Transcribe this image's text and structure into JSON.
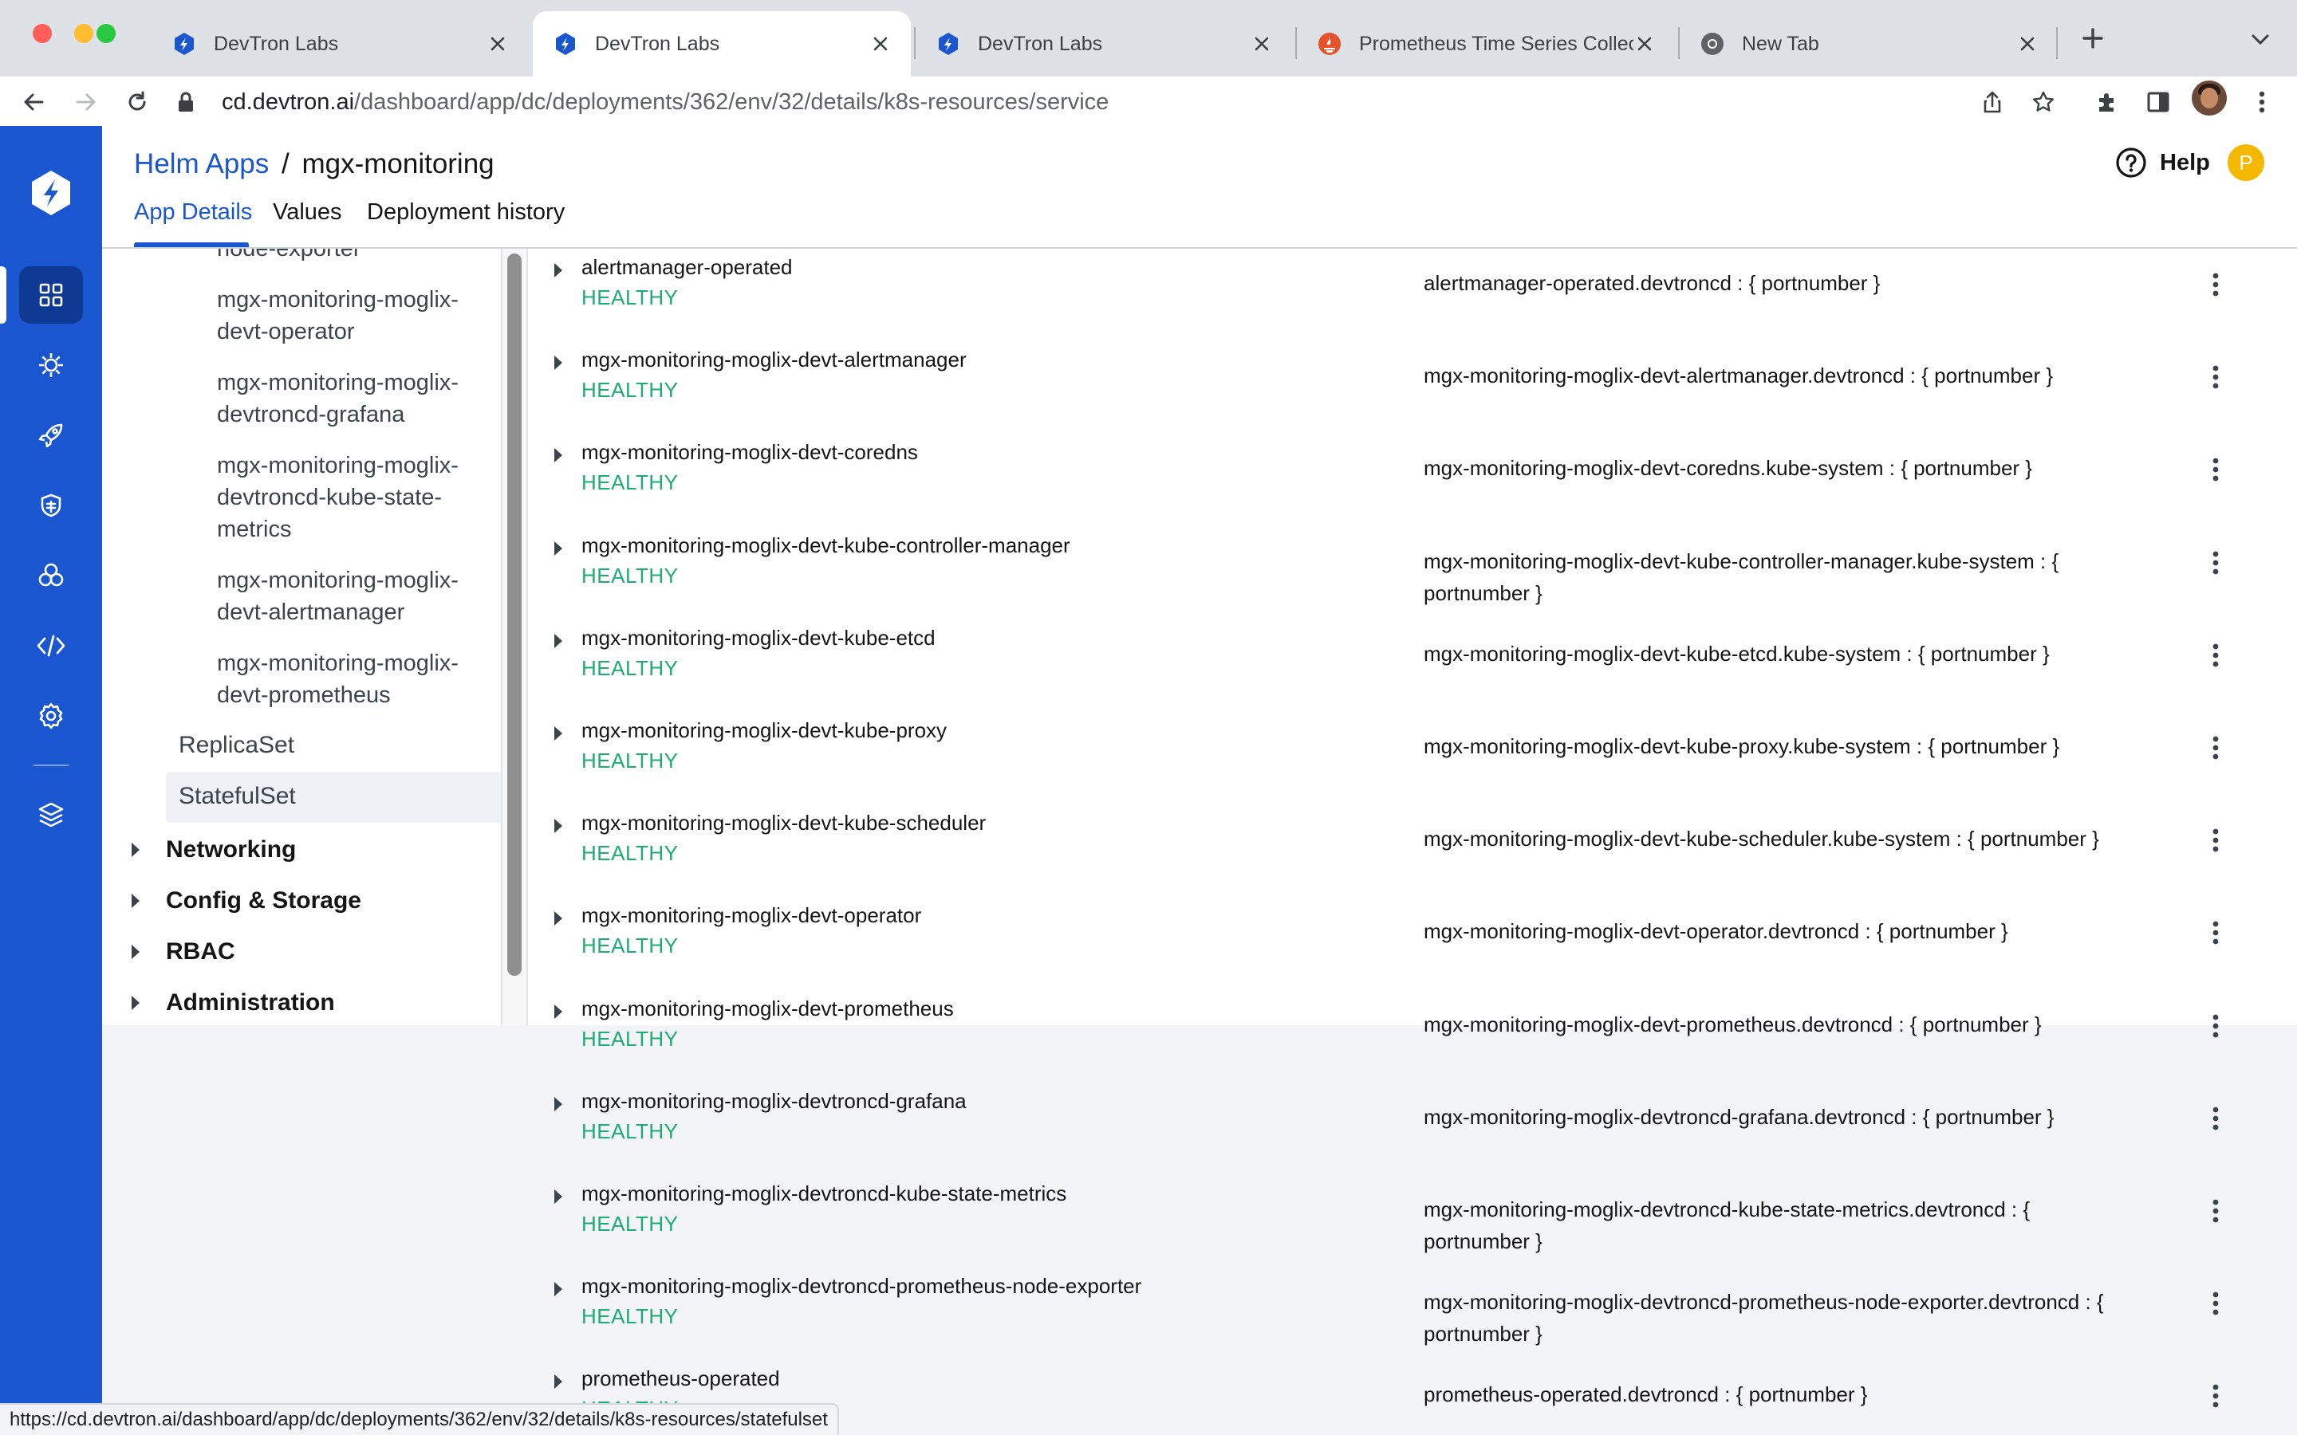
{
  "browser": {
    "tabs": [
      {
        "title": "DevTron Labs",
        "favicon": "devtron-favicon-icon",
        "active": false
      },
      {
        "title": "DevTron Labs",
        "favicon": "devtron-favicon-icon",
        "active": true
      },
      {
        "title": "DevTron Labs",
        "favicon": "devtron-favicon-icon",
        "active": false
      },
      {
        "title": "Prometheus Time Series Collec",
        "favicon": "prometheus-favicon-icon",
        "active": false
      },
      {
        "title": "New Tab",
        "favicon": "chrome-favicon-icon",
        "active": false
      }
    ],
    "url_domain": "cd.devtron.ai",
    "url_path": "/dashboard/app/dc/deployments/362/env/32/details/k8s-resources/service",
    "status_url": "https://cd.devtron.ai/dashboard/app/dc/deployments/362/env/32/details/k8s-resources/statefulset"
  },
  "header": {
    "breadcrumb_root": "Helm Apps",
    "breadcrumb_sep": "/",
    "breadcrumb_current": "mgx-monitoring",
    "help_label": "Help",
    "user_initial": "P",
    "tabs": [
      {
        "label": "App Details",
        "active": true
      },
      {
        "label": "Values",
        "active": false
      },
      {
        "label": "Deployment history",
        "active": false
      }
    ]
  },
  "tree": {
    "cut_leaf": "node-exporter",
    "leaves": [
      [
        "mgx-monitoring-moglix-",
        "devt-operator"
      ],
      [
        "mgx-monitoring-moglix-",
        "devtroncd-grafana"
      ],
      [
        "mgx-monitoring-moglix-",
        "devtroncd-kube-state-",
        "metrics"
      ],
      [
        "mgx-monitoring-moglix-",
        "devt-alertmanager"
      ],
      [
        "mgx-monitoring-moglix-",
        "devt-prometheus"
      ]
    ],
    "kinds": [
      "ReplicaSet",
      "StatefulSet"
    ],
    "selected_kind": "StatefulSet",
    "groups": [
      "Networking",
      "Config & Storage",
      "RBAC",
      "Administration"
    ]
  },
  "services": [
    {
      "name": "alertmanager-operated",
      "status": "HEALTHY",
      "endpoint": "alertmanager-operated.devtroncd : { portnumber }"
    },
    {
      "name": "mgx-monitoring-moglix-devt-alertmanager",
      "status": "HEALTHY",
      "endpoint": "mgx-monitoring-moglix-devt-alertmanager.devtroncd : { portnumber }"
    },
    {
      "name": "mgx-monitoring-moglix-devt-coredns",
      "status": "HEALTHY",
      "endpoint": "mgx-monitoring-moglix-devt-coredns.kube-system : { portnumber }"
    },
    {
      "name": "mgx-monitoring-moglix-devt-kube-controller-manager",
      "status": "HEALTHY",
      "endpoint": "mgx-monitoring-moglix-devt-kube-controller-manager.kube-system : { portnumber }"
    },
    {
      "name": "mgx-monitoring-moglix-devt-kube-etcd",
      "status": "HEALTHY",
      "endpoint": "mgx-monitoring-moglix-devt-kube-etcd.kube-system : { portnumber }"
    },
    {
      "name": "mgx-monitoring-moglix-devt-kube-proxy",
      "status": "HEALTHY",
      "endpoint": "mgx-monitoring-moglix-devt-kube-proxy.kube-system : { portnumber }"
    },
    {
      "name": "mgx-monitoring-moglix-devt-kube-scheduler",
      "status": "HEALTHY",
      "endpoint": "mgx-monitoring-moglix-devt-kube-scheduler.kube-system : { portnumber }"
    },
    {
      "name": "mgx-monitoring-moglix-devt-operator",
      "status": "HEALTHY",
      "endpoint": "mgx-monitoring-moglix-devt-operator.devtroncd : { portnumber }"
    },
    {
      "name": "mgx-monitoring-moglix-devt-prometheus",
      "status": "HEALTHY",
      "endpoint": "mgx-monitoring-moglix-devt-prometheus.devtroncd : { portnumber }"
    },
    {
      "name": "mgx-monitoring-moglix-devtroncd-grafana",
      "status": "HEALTHY",
      "endpoint": "mgx-monitoring-moglix-devtroncd-grafana.devtroncd : { portnumber }"
    },
    {
      "name": "mgx-monitoring-moglix-devtroncd-kube-state-metrics",
      "status": "HEALTHY",
      "endpoint": "mgx-monitoring-moglix-devtroncd-kube-state-metrics.devtroncd : { portnumber }"
    },
    {
      "name": "mgx-monitoring-moglix-devtroncd-prometheus-node-exporter",
      "status": "HEALTHY",
      "endpoint": "mgx-monitoring-moglix-devtroncd-prometheus-node-exporter.devtroncd : { portnumber }"
    },
    {
      "name": "prometheus-operated",
      "status": "HEALTHY",
      "endpoint": "prometheus-operated.devtroncd : { portnumber }"
    }
  ],
  "rail_items": [
    {
      "icon": "applications-grid-icon",
      "active": true
    },
    {
      "icon": "chart-store-icon",
      "active": false
    },
    {
      "icon": "deploy-rocket-icon",
      "active": false
    },
    {
      "icon": "security-bug-icon",
      "active": false
    },
    {
      "icon": "global-configurations-icon",
      "active": false
    },
    {
      "icon": "code-icon",
      "active": false
    },
    {
      "icon": "settings-gear-icon",
      "active": false
    },
    {
      "icon": "stack-layers-icon",
      "active": false
    }
  ],
  "colors": {
    "brand_blue": "#1a56cf",
    "healthy_green": "#1dad70",
    "rail_active": "#0e3a93",
    "avatar_yellow": "#f5b800"
  }
}
